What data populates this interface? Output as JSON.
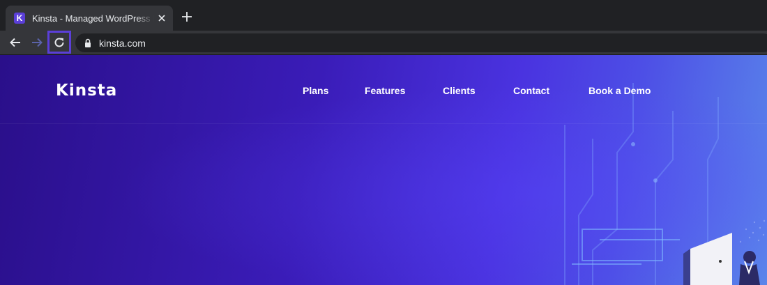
{
  "browser": {
    "tab": {
      "title": "Kinsta - Managed WordPress Hosting",
      "favicon_letter": "K"
    },
    "address": {
      "url": "kinsta.com"
    }
  },
  "site": {
    "logo": "Kinsta",
    "nav": [
      "Plans",
      "Features",
      "Clients",
      "Contact",
      "Book a Demo"
    ]
  },
  "colors": {
    "highlight": "#5b3fd8",
    "chrome_bg": "#202124",
    "toolbar_bg": "#35363a",
    "hero_start": "#2a0f8a",
    "hero_end": "#5a86ea"
  }
}
